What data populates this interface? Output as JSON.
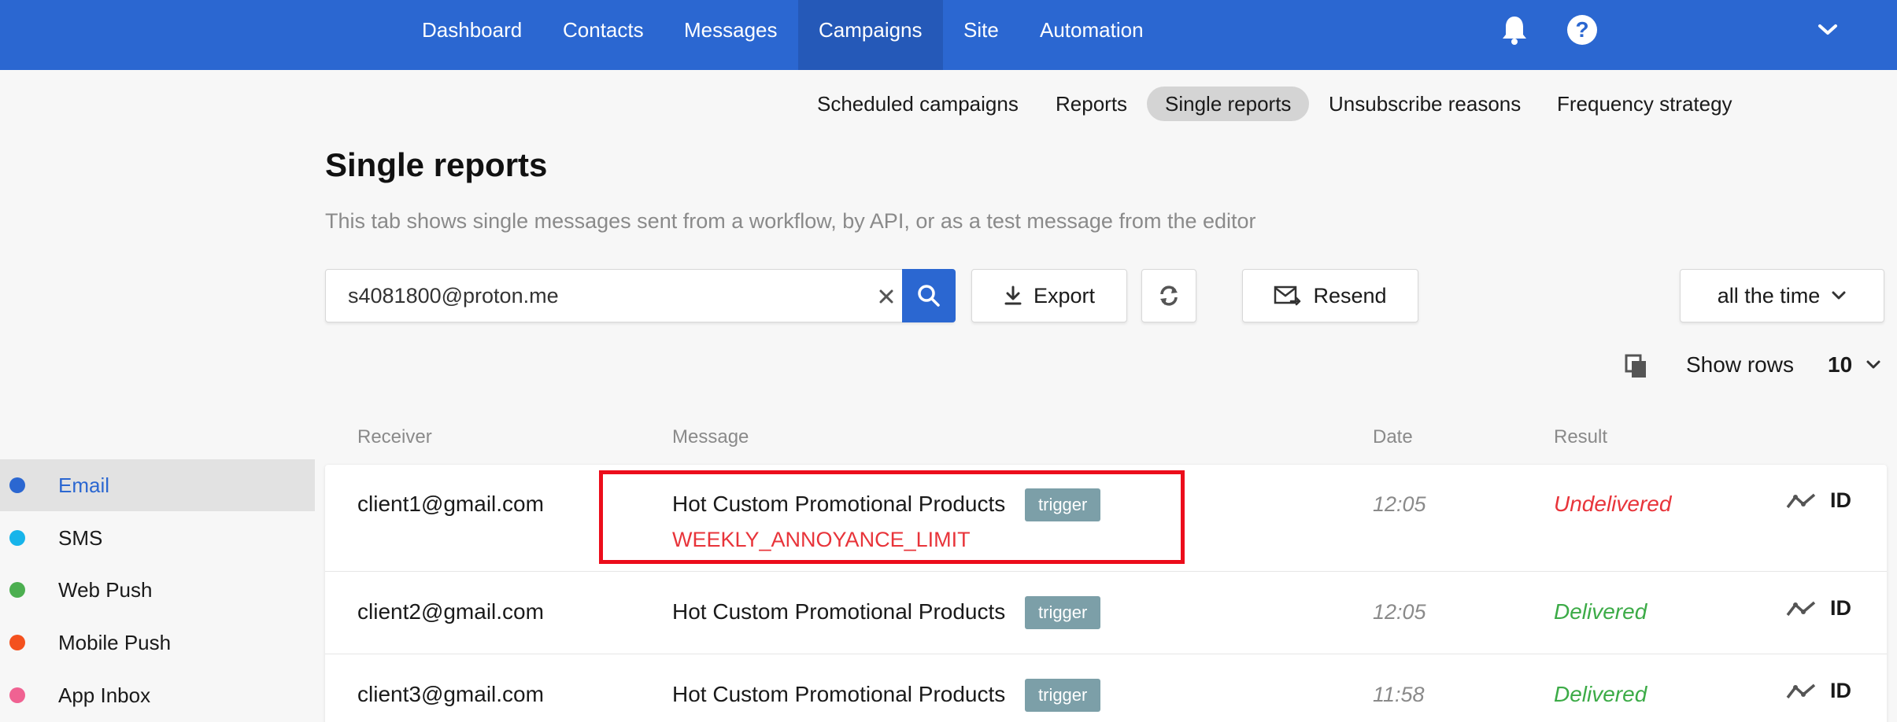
{
  "nav": {
    "items": [
      {
        "label": "Dashboard"
      },
      {
        "label": "Contacts"
      },
      {
        "label": "Messages"
      },
      {
        "label": "Campaigns"
      },
      {
        "label": "Site"
      },
      {
        "label": "Automation"
      }
    ],
    "active": "Campaigns"
  },
  "subnav": {
    "items": [
      {
        "label": "Scheduled campaigns"
      },
      {
        "label": "Reports"
      },
      {
        "label": "Single reports"
      },
      {
        "label": "Unsubscribe reasons"
      },
      {
        "label": "Frequency strategy"
      }
    ],
    "active": "Single reports"
  },
  "page": {
    "title": "Single reports",
    "description": "This tab shows single messages sent from a workflow, by API, or as a test message from the editor"
  },
  "search": {
    "value": "s4081800@proton.me"
  },
  "toolbar": {
    "export_label": "Export",
    "resend_label": "Resend",
    "period_label": "all the time",
    "show_rows_label": "Show rows",
    "show_rows_value": "10"
  },
  "sidebar": {
    "items": [
      {
        "label": "Email",
        "color": "#2b67d1"
      },
      {
        "label": "SMS",
        "color": "#17b4ea"
      },
      {
        "label": "Web Push",
        "color": "#4caf50"
      },
      {
        "label": "Mobile Push",
        "color": "#f4511e"
      },
      {
        "label": "App Inbox",
        "color": "#f06292"
      }
    ],
    "active": "Email"
  },
  "table": {
    "headers": {
      "receiver": "Receiver",
      "message": "Message",
      "date": "Date",
      "result": "Result"
    },
    "rows": [
      {
        "receiver": "client1@gmail.com",
        "message": "Hot Custom Promotional Products",
        "badge": "trigger",
        "error": "WEEKLY_ANNOYANCE_LIMIT",
        "date": "12:05",
        "result": "Undelivered",
        "id": "ID"
      },
      {
        "receiver": "client2@gmail.com",
        "message": "Hot Custom Promotional Products",
        "badge": "trigger",
        "date": "12:05",
        "result": "Delivered",
        "id": "ID"
      },
      {
        "receiver": "client3@gmail.com",
        "message": "Hot Custom Promotional Products",
        "badge": "trigger",
        "date": "11:58",
        "result": "Delivered",
        "id": "ID"
      }
    ]
  },
  "colors": {
    "brand": "#2b67d1",
    "error": "#e8343a",
    "success": "#3cab47",
    "highlight": "#ec0d1b"
  }
}
